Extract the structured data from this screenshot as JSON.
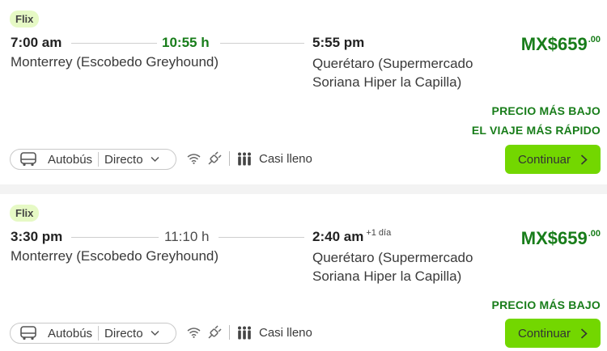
{
  "colors": {
    "accent_green": "#73d700",
    "price_green": "#187d1a",
    "badge_bg": "#e6f9c5"
  },
  "trips": [
    {
      "badge": "Flix",
      "departure_time": "7:00 am",
      "duration": "10:55 h",
      "arrival_time": "5:55 pm",
      "arrival_day_note": "",
      "origin": "Monterrey (Escobedo Greyhound)",
      "destination": "Querétaro (Supermercado Soriana Hiper la Capilla)",
      "price_main": "MX$659",
      "price_cents": ".00",
      "tags": [
        "PRECIO MÁS BAJO",
        "EL VIAJE MÁS RÁPIDO"
      ],
      "mode": "Autobús",
      "route_type": "Directo",
      "occupancy": "Casi lleno",
      "button_label": "Continuar",
      "icons": [
        "bus-icon",
        "chevron-down-icon",
        "wifi-icon",
        "power-plug-icon",
        "seats-icon",
        "chevron-right-icon"
      ]
    },
    {
      "badge": "Flix",
      "departure_time": "3:30 pm",
      "duration": "11:10 h",
      "arrival_time": "2:40 am",
      "arrival_day_note": "+1 día",
      "origin": "Monterrey (Escobedo Greyhound)",
      "destination": "Querétaro (Supermercado Soriana Hiper la Capilla)",
      "price_main": "MX$659",
      "price_cents": ".00",
      "tags": [
        "PRECIO MÁS BAJO"
      ],
      "mode": "Autobús",
      "route_type": "Directo",
      "occupancy": "Casi lleno",
      "button_label": "Continuar",
      "icons": [
        "bus-icon",
        "chevron-down-icon",
        "wifi-icon",
        "power-plug-icon",
        "seats-icon",
        "chevron-right-icon"
      ]
    }
  ]
}
